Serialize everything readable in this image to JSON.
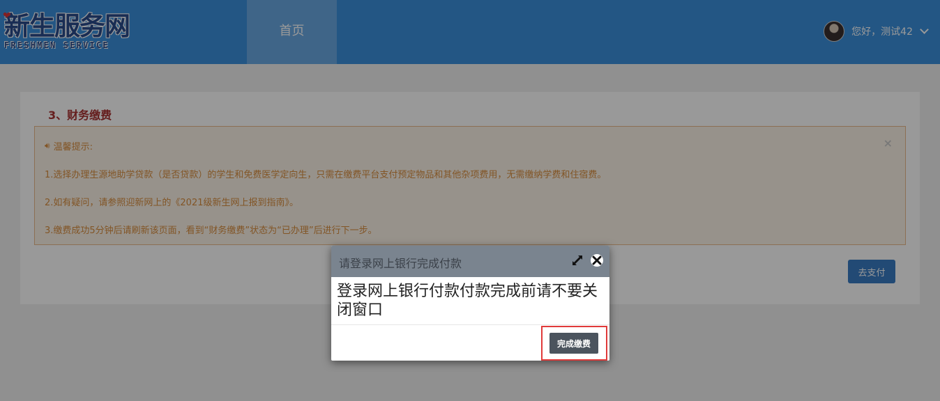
{
  "header": {
    "logo_main": "新生服务网",
    "logo_sub": "FRESHMEN SERVICE",
    "nav_home": "首页",
    "user_greeting": "您好，测试42"
  },
  "section": {
    "title": "3、财务缴费",
    "notice_title": "温馨提示:",
    "notice_close": "×",
    "notice_lines": [
      "1.选择办理生源地助学贷款（是否贷款）的学生和免费医学定向生，只需在缴费平台支付预定物品和其他杂项费用，无需缴纳学费和住宿费。",
      "2.如有疑问，请参照迎新网上的《2021级新生网上报到指南》。",
      "3.缴费成功5分钟后请刷新该页面，看到“财务缴费”状态为“已办理”后进行下一步。"
    ],
    "go_pay_button": "去支付"
  },
  "modal": {
    "title": "请登录网上银行完成付款",
    "body": "登录网上银行付款付款完成前请不要关闭窗口",
    "finish_button": "完成缴费"
  }
}
